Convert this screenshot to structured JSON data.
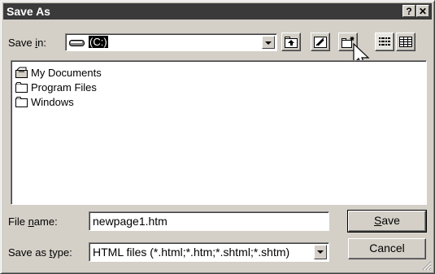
{
  "window": {
    "title": "Save As",
    "help_label": "?",
    "close_label": "✕"
  },
  "save_in": {
    "label_pre": "Save ",
    "label_mn": "i",
    "label_post": "n:",
    "value": "(C:)"
  },
  "files": [
    {
      "name": "My Documents",
      "icon": "my-documents-icon"
    },
    {
      "name": "Program Files",
      "icon": "folder-icon"
    },
    {
      "name": "Windows",
      "icon": "folder-icon"
    }
  ],
  "file_name": {
    "label_pre": "File ",
    "label_mn": "n",
    "label_post": "ame:",
    "value": "newpage1.htm"
  },
  "save_type": {
    "label_pre": "Save as ",
    "label_mn": "t",
    "label_post": "ype:",
    "value": "HTML files (*.html;*.htm;*.shtml;*.shtm)"
  },
  "buttons": {
    "save_mn": "S",
    "save_rest": "ave",
    "cancel": "Cancel"
  },
  "colors": {
    "titlebar": "#3a3a3a",
    "face": "#d4d0c8",
    "selection": "#000000"
  }
}
